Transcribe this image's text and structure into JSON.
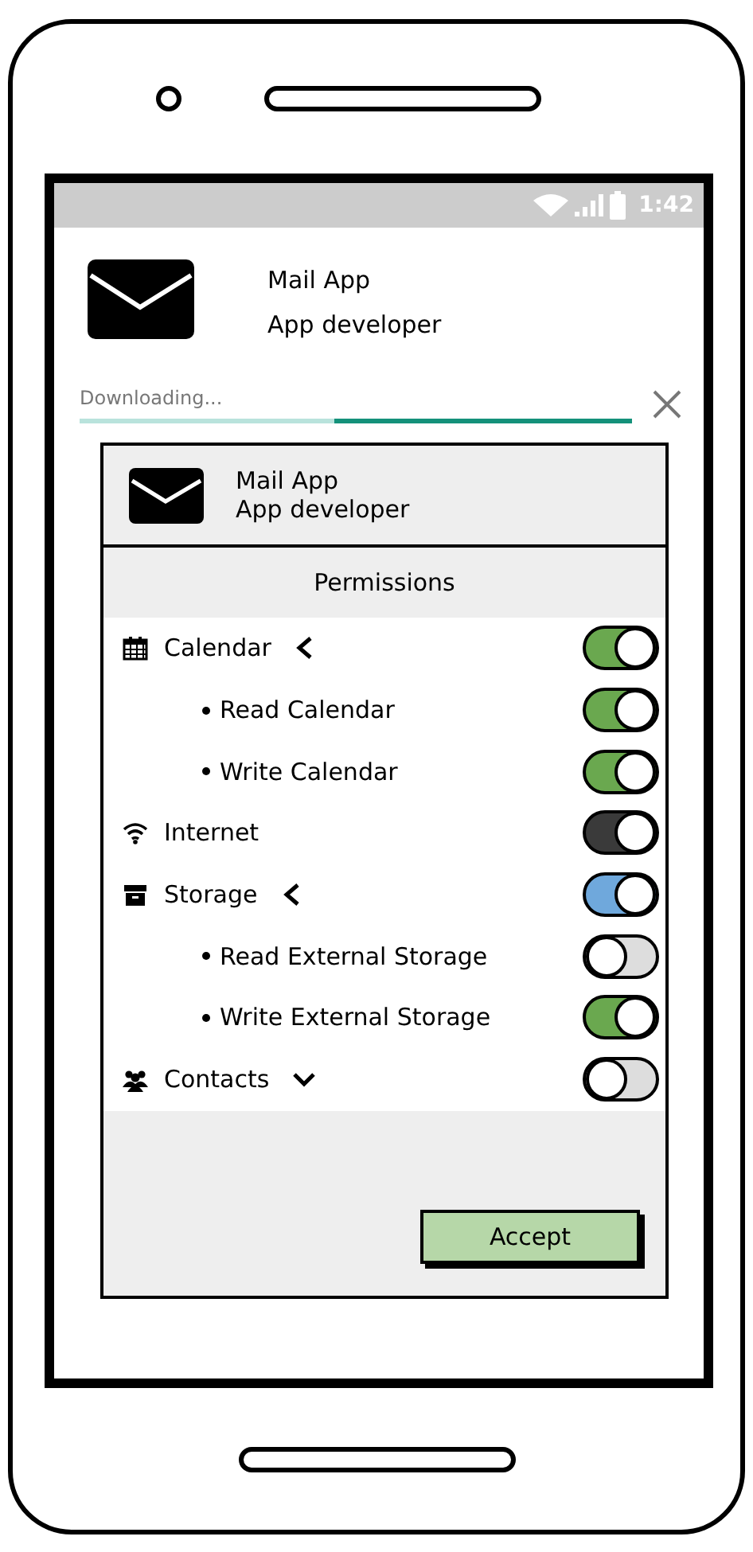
{
  "status_bar": {
    "time": "1:42"
  },
  "app": {
    "name": "Mail App",
    "developer": "App developer"
  },
  "download": {
    "label": "Downloading...",
    "level": 0.54
  },
  "dialog": {
    "app_name": "Mail App",
    "developer": "App developer",
    "title": "Permissions",
    "permissions": [
      {
        "kind": "calendar",
        "label": "Calendar",
        "expanded": true,
        "on": true,
        "color": "#6aa84f",
        "children": [
          {
            "label": "Read Calendar",
            "on": true,
            "color": "#6aa84f"
          },
          {
            "label": "Write Calendar",
            "on": true,
            "color": "#6aa84f"
          }
        ]
      },
      {
        "kind": "internet",
        "label": "Internet",
        "on": true,
        "color": "#3a3a3a"
      },
      {
        "kind": "storage",
        "label": "Storage",
        "expanded": true,
        "on": true,
        "color": "#6fa8dc",
        "children": [
          {
            "label": "Read External Storage",
            "on": false,
            "color": "#dddddd"
          },
          {
            "label": "Write External Storage",
            "on": true,
            "color": "#6aa84f"
          }
        ]
      },
      {
        "kind": "contacts",
        "label": "Contacts",
        "expanded": false,
        "on": false,
        "color": "#dddddd"
      }
    ],
    "button": "Accept"
  }
}
